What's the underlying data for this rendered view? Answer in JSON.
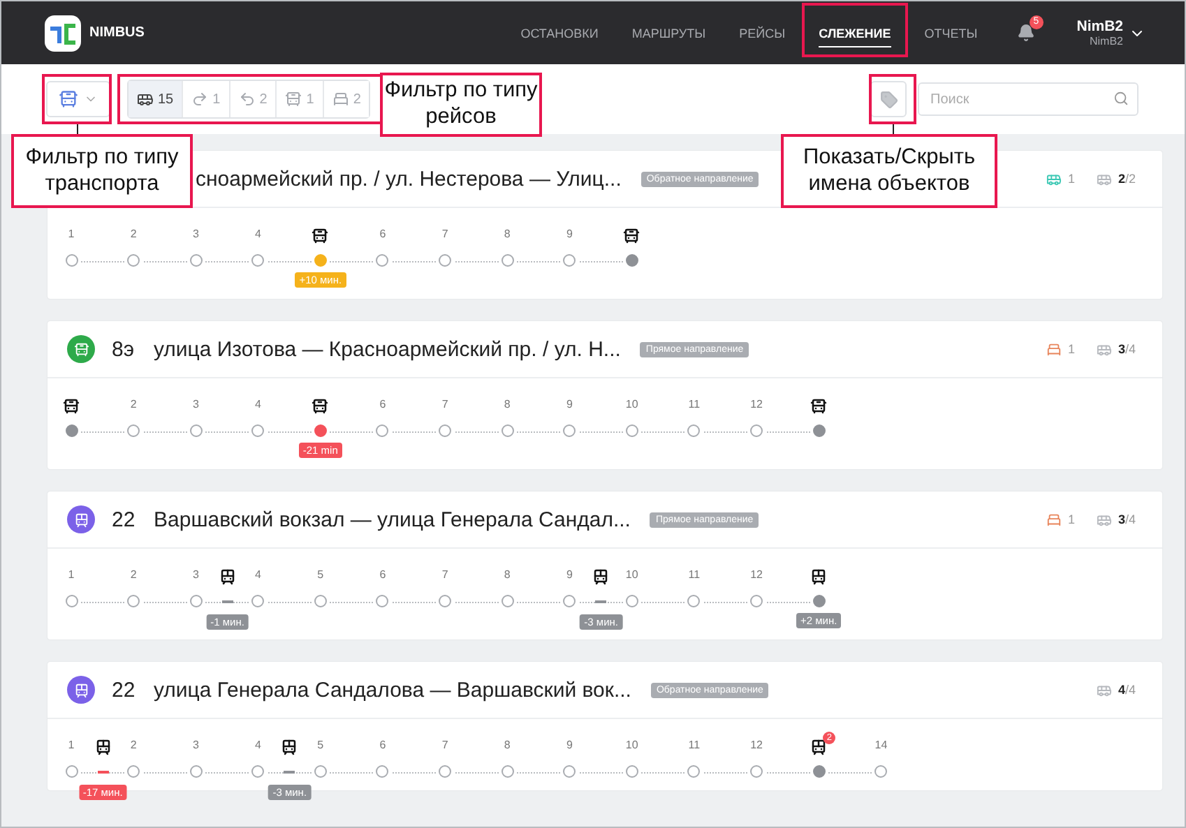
{
  "header": {
    "brand": "NIMBUS",
    "nav": [
      {
        "label": "ОСТАНОВКИ",
        "selected": false
      },
      {
        "label": "МАРШРУТЫ",
        "selected": false
      },
      {
        "label": "РЕЙСЫ",
        "selected": false
      },
      {
        "label": "СЛЕЖЕНИЕ",
        "selected": true
      },
      {
        "label": "ОТЧЕТЫ",
        "selected": false
      }
    ],
    "notifications": "5",
    "user": {
      "name": "NimB2",
      "sub": "NimB2"
    }
  },
  "toolbar": {
    "trip_filters": [
      {
        "kind": "bus",
        "count": "15",
        "selected": true
      },
      {
        "kind": "turn",
        "count": "1",
        "selected": false
      },
      {
        "kind": "return",
        "count": "2",
        "selected": false
      },
      {
        "kind": "off",
        "count": "1",
        "selected": false
      },
      {
        "kind": "depot",
        "count": "2",
        "selected": false
      }
    ],
    "search": {
      "placeholder": "Поиск"
    }
  },
  "routes": [
    {
      "title": "сноармейский пр. / ул. Нестерова — Улиц...",
      "direction": "Обратное направление",
      "stats": [
        {
          "kind": "active",
          "value": "1"
        },
        {
          "kind": "fleet",
          "value": "**2**/2"
        }
      ],
      "timeline": [
        {
          "kind": "stop",
          "label": "1"
        },
        {
          "kind": "stop",
          "label": "2"
        },
        {
          "kind": "stop",
          "label": "3"
        },
        {
          "kind": "stop",
          "label": "4"
        },
        {
          "kind": "stop",
          "vehicle": true,
          "filled": true,
          "color": "#f5b21b",
          "badge": "+10 мин."
        },
        {
          "kind": "stop",
          "label": "6"
        },
        {
          "kind": "stop",
          "label": "7"
        },
        {
          "kind": "stop",
          "label": "8"
        },
        {
          "kind": "stop",
          "label": "9"
        },
        {
          "kind": "stop",
          "vehicle": true,
          "filled": true
        }
      ]
    },
    {
      "kind": "bus",
      "color": "#2eaa4a",
      "number": "8э",
      "title": "улица Изотова — Красноармейский пр. / ул. Н...",
      "direction": "Прямое направление",
      "stats": [
        {
          "kind": "depot",
          "value": "1"
        },
        {
          "kind": "fleet",
          "value": "**3**/4"
        }
      ],
      "timeline": [
        {
          "kind": "stop",
          "vehicle": true,
          "filled": true
        },
        {
          "kind": "stop",
          "label": "2"
        },
        {
          "kind": "stop",
          "label": "3"
        },
        {
          "kind": "stop",
          "label": "4"
        },
        {
          "kind": "stop",
          "vehicle": true,
          "filled": true,
          "color": "#f4515a",
          "badge": "-21 min"
        },
        {
          "kind": "stop",
          "label": "6"
        },
        {
          "kind": "stop",
          "label": "7"
        },
        {
          "kind": "stop",
          "label": "8"
        },
        {
          "kind": "stop",
          "label": "9"
        },
        {
          "kind": "stop",
          "label": "10"
        },
        {
          "kind": "stop",
          "label": "11"
        },
        {
          "kind": "stop",
          "label": "12"
        },
        {
          "kind": "stop",
          "vehicle": true,
          "filled": true
        }
      ]
    },
    {
      "kind": "trolleybus",
      "color": "#7b61e8",
      "number": "22",
      "title": "Варшавский вокзал — улица Генерала Сандал...",
      "direction": "Прямое направление",
      "stats": [
        {
          "kind": "depot",
          "value": "1"
        },
        {
          "kind": "fleet",
          "value": "**3**/4"
        }
      ],
      "timeline": [
        {
          "kind": "stop",
          "label": "1"
        },
        {
          "kind": "stop",
          "label": "2"
        },
        {
          "kind": "stop",
          "label": "3"
        },
        {
          "kind": "vehicle",
          "badge": "-1 мин.",
          "color": "#8e9196"
        },
        {
          "kind": "stop",
          "label": "4"
        },
        {
          "kind": "stop",
          "label": "5"
        },
        {
          "kind": "stop",
          "label": "6"
        },
        {
          "kind": "stop",
          "label": "7"
        },
        {
          "kind": "stop",
          "label": "8"
        },
        {
          "kind": "stop",
          "label": "9"
        },
        {
          "kind": "vehicle",
          "badge": "-3 мин.",
          "color": "#8e9196"
        },
        {
          "kind": "stop",
          "label": "10"
        },
        {
          "kind": "stop",
          "label": "11"
        },
        {
          "kind": "stop",
          "label": "12"
        },
        {
          "kind": "stop",
          "vehicle": true,
          "filled": true,
          "color": "#8e9196",
          "badge": "+2 мин."
        }
      ]
    },
    {
      "kind": "trolleybus",
      "color": "#7b61e8",
      "number": "22",
      "title": "улица Генерала Сандалова — Варшавский вок...",
      "direction": "Обратное направление",
      "stats": [
        {
          "kind": "fleet",
          "value": "**4**/4"
        }
      ],
      "timeline": [
        {
          "kind": "stop",
          "label": "1"
        },
        {
          "kind": "vehicle",
          "badge": "-17 мин.",
          "color": "#f4515a"
        },
        {
          "kind": "stop",
          "label": "2"
        },
        {
          "kind": "stop",
          "label": "3"
        },
        {
          "kind": "stop",
          "label": "4"
        },
        {
          "kind": "vehicle",
          "badge": "-3 мин.",
          "color": "#8e9196"
        },
        {
          "kind": "stop",
          "label": "5"
        },
        {
          "kind": "stop",
          "label": "6"
        },
        {
          "kind": "stop",
          "label": "7"
        },
        {
          "kind": "stop",
          "label": "8"
        },
        {
          "kind": "stop",
          "label": "9"
        },
        {
          "kind": "stop",
          "label": "10"
        },
        {
          "kind": "stop",
          "label": "11"
        },
        {
          "kind": "stop",
          "label": "12"
        },
        {
          "kind": "stop",
          "vehicle": true,
          "filled": true,
          "count": "2"
        },
        {
          "kind": "stop",
          "label": "14"
        }
      ]
    }
  ],
  "annotations": [
    {
      "kind": "tab"
    },
    {
      "kind": "transport_filter",
      "text": "Фильтр по типу транспорта"
    },
    {
      "kind": "trip_filter",
      "text": "Фильтр по типу рейсов"
    },
    {
      "kind": "names_toggle",
      "text": "Показать/Скрыть имена объектов"
    }
  ]
}
